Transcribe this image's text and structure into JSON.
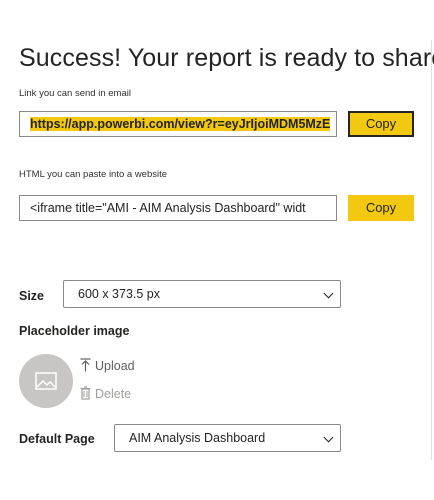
{
  "dialog": {
    "title": "Success! Your report is ready to share"
  },
  "link_section": {
    "label": "Link you can send in email",
    "value": "https://app.powerbi.com/view?r=eyJrIjoiMDM5MzE",
    "copy_label": "Copy"
  },
  "html_section": {
    "label": "HTML you can paste into a website",
    "value": "<iframe title=\"AMI - AIM Analysis Dashboard\" widt",
    "copy_label": "Copy"
  },
  "size": {
    "label": "Size",
    "selected": "600 x 373.5 px"
  },
  "placeholder": {
    "label": "Placeholder image",
    "upload_label": "Upload",
    "delete_label": "Delete"
  },
  "default_page": {
    "label": "Default Page",
    "selected": "AIM Analysis Dashboard"
  },
  "colors": {
    "accent": "#f2c811",
    "text": "#252423",
    "border": "#8a8886",
    "placeholder_bg": "#c8c6c4"
  },
  "icons": [
    "image-icon",
    "upload-icon",
    "delete-icon",
    "chevron-down-icon"
  ]
}
